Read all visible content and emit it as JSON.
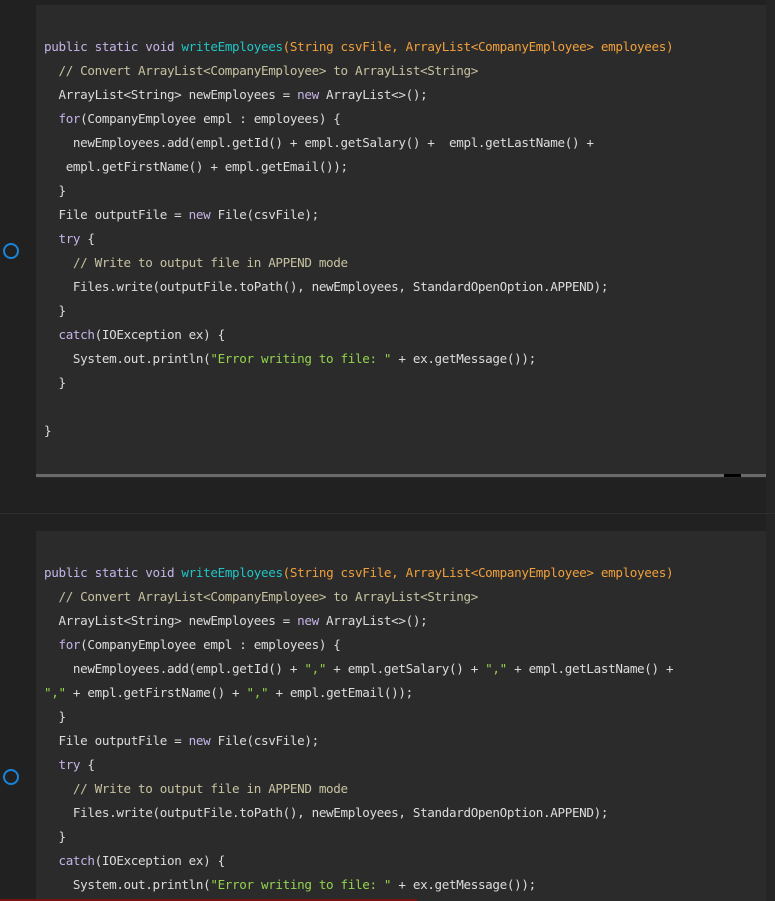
{
  "cells": [
    {
      "id": "cell-1",
      "lines": [
        [
          [
            "kw",
            "public static void "
          ],
          [
            "fn",
            "writeEmployees"
          ],
          [
            "param",
            "(String csvFile, ArrayList<CompanyEmployee> employees)"
          ]
        ],
        [
          [
            "pl",
            "  "
          ],
          [
            "cm",
            "// Convert ArrayList<CompanyEmployee> to ArrayList<String>"
          ]
        ],
        [
          [
            "pl",
            "  ArrayList<String> newEmployees = "
          ],
          [
            "kw",
            "new"
          ],
          [
            "pl",
            " ArrayList<>();"
          ]
        ],
        [
          [
            "pl",
            "  "
          ],
          [
            "kw",
            "for"
          ],
          [
            "pl",
            "(CompanyEmployee empl : employees) {"
          ]
        ],
        [
          [
            "pl",
            "    newEmployees.add(empl.getId() + empl.getSalary() +  empl.getLastName() +"
          ]
        ],
        [
          [
            "pl",
            "   empl.getFirstName() + empl.getEmail());"
          ]
        ],
        [
          [
            "pl",
            "  }"
          ]
        ],
        [
          [
            "pl",
            "  File outputFile = "
          ],
          [
            "kw",
            "new"
          ],
          [
            "pl",
            " File(csvFile);"
          ]
        ],
        [
          [
            "pl",
            "  "
          ],
          [
            "kw",
            "try"
          ],
          [
            "pl",
            " {"
          ]
        ],
        [
          [
            "pl",
            "    "
          ],
          [
            "cm",
            "// Write to output file in APPEND mode"
          ]
        ],
        [
          [
            "pl",
            "    Files.write(outputFile.toPath(), newEmployees, StandardOpenOption.APPEND);"
          ]
        ],
        [
          [
            "pl",
            "  }"
          ]
        ],
        [
          [
            "pl",
            "  "
          ],
          [
            "kw",
            "catch"
          ],
          [
            "pl",
            "(IOException ex) {"
          ]
        ],
        [
          [
            "pl",
            "    System.out.println("
          ],
          [
            "str",
            "\"Error writing to file: \""
          ],
          [
            "pl",
            " + ex.getMessage());"
          ]
        ],
        [
          [
            "pl",
            "  }"
          ]
        ],
        [
          [
            "pl",
            ""
          ]
        ],
        [
          [
            "pl",
            "}"
          ]
        ]
      ]
    },
    {
      "id": "cell-2",
      "lines": [
        [
          [
            "kw",
            "public static void "
          ],
          [
            "fn",
            "writeEmployees"
          ],
          [
            "param",
            "(String csvFile, ArrayList<CompanyEmployee> employees)"
          ]
        ],
        [
          [
            "pl",
            "  "
          ],
          [
            "cm",
            "// Convert ArrayList<CompanyEmployee> to ArrayList<String>"
          ]
        ],
        [
          [
            "pl",
            "  ArrayList<String> newEmployees = "
          ],
          [
            "kw",
            "new"
          ],
          [
            "pl",
            " ArrayList<>();"
          ]
        ],
        [
          [
            "pl",
            "  "
          ],
          [
            "kw",
            "for"
          ],
          [
            "pl",
            "(CompanyEmployee empl : employees) {"
          ]
        ],
        [
          [
            "pl",
            "    newEmployees.add(empl.getId() + "
          ],
          [
            "str",
            "\",\""
          ],
          [
            "pl",
            " + empl.getSalary() + "
          ],
          [
            "str",
            "\",\""
          ],
          [
            "pl",
            " + empl.getLastName() +"
          ]
        ],
        [
          [
            "str",
            "\",\""
          ],
          [
            "pl",
            " + empl.getFirstName() + "
          ],
          [
            "str",
            "\",\""
          ],
          [
            "pl",
            " + empl.getEmail());"
          ]
        ],
        [
          [
            "pl",
            "  }"
          ]
        ],
        [
          [
            "pl",
            "  File outputFile = "
          ],
          [
            "kw",
            "new"
          ],
          [
            "pl",
            " File(csvFile);"
          ]
        ],
        [
          [
            "pl",
            "  "
          ],
          [
            "kw",
            "try"
          ],
          [
            "pl",
            " {"
          ]
        ],
        [
          [
            "pl",
            "    "
          ],
          [
            "cm",
            "// Write to output file in APPEND mode"
          ]
        ],
        [
          [
            "pl",
            "    Files.write(outputFile.toPath(), newEmployees, StandardOpenOption.APPEND);"
          ]
        ],
        [
          [
            "pl",
            "  }"
          ]
        ],
        [
          [
            "pl",
            "  "
          ],
          [
            "kw",
            "catch"
          ],
          [
            "pl",
            "(IOException ex) {"
          ]
        ],
        [
          [
            "pl",
            "    System.out.println("
          ],
          [
            "str",
            "\"Error writing to file: \""
          ],
          [
            "pl",
            " + ex.getMessage());"
          ]
        ]
      ]
    }
  ],
  "icons": {
    "run_indicator": "circle-outline-icon"
  },
  "colors": {
    "background": "#212121",
    "code_panel": "#2b2b2b",
    "keyword": "#c5b4e8",
    "function_name": "#20c5c5",
    "parameters": "#f0a03c",
    "comment": "#c7c2a0",
    "string": "#93d34e",
    "plain": "#dcdcdc",
    "run_indicator": "#1a84d8"
  }
}
